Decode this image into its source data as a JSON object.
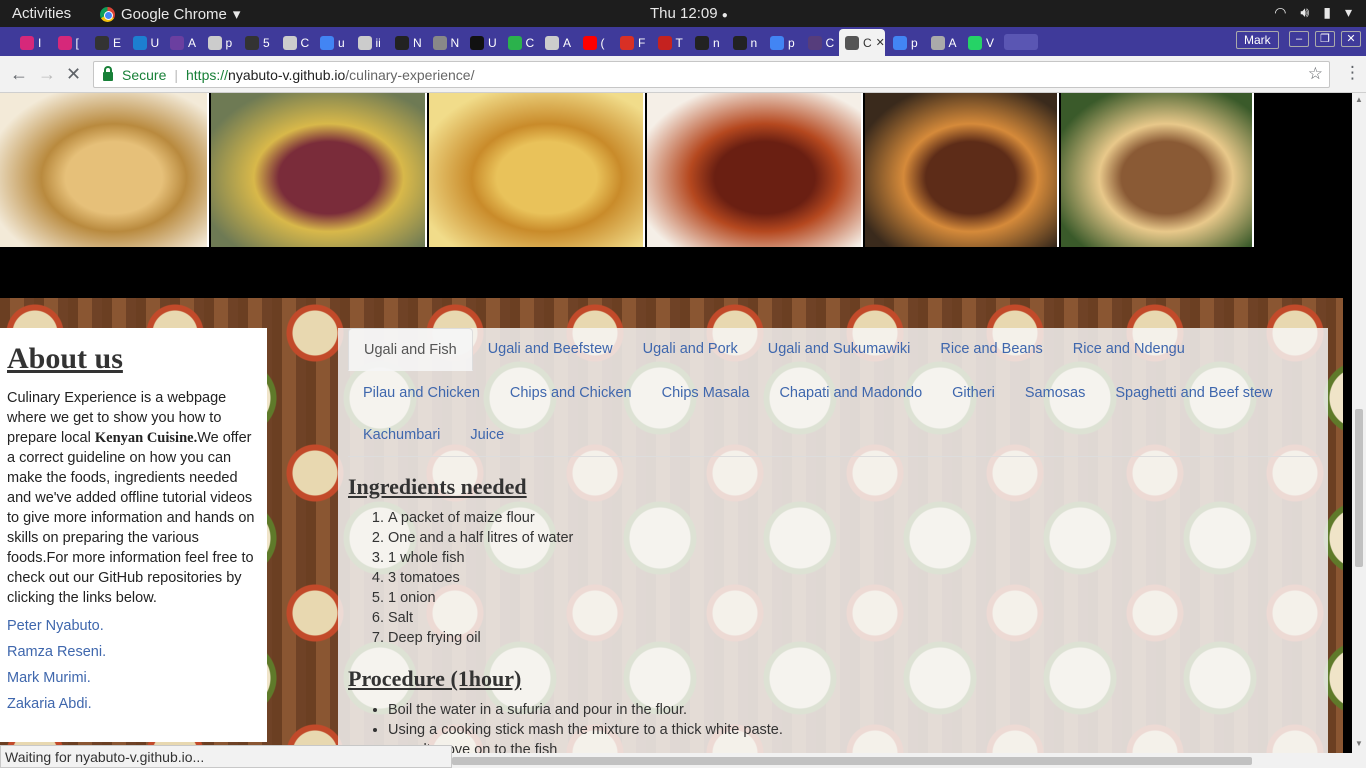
{
  "topbar": {
    "activities": "Activities",
    "app_name": "Google Chrome",
    "clock": "Thu 12:09",
    "clock_dot": "●"
  },
  "tabs": [
    {
      "label": "I",
      "color": "#d6287a"
    },
    {
      "label": "[",
      "color": "#d6287a"
    },
    {
      "label": "E",
      "color": "#333333"
    },
    {
      "label": "U",
      "color": "#1d7fd1"
    },
    {
      "label": "A",
      "color": "#6b3fa0"
    },
    {
      "label": "p",
      "color": "#cccccc"
    },
    {
      "label": "5",
      "color": "#333333"
    },
    {
      "label": "C",
      "color": "#cccccc"
    },
    {
      "label": "u",
      "color": "#4285f4"
    },
    {
      "label": "ii",
      "color": "#cccccc"
    },
    {
      "label": "N",
      "color": "#222222"
    },
    {
      "label": "N",
      "color": "#888888"
    },
    {
      "label": "U",
      "color": "#111111"
    },
    {
      "label": "C",
      "color": "#2bb24c"
    },
    {
      "label": "A",
      "color": "#cccccc"
    },
    {
      "label": "(",
      "color": "#ff0000"
    },
    {
      "label": "F",
      "color": "#d93025"
    },
    {
      "label": "T",
      "color": "#c5221f"
    },
    {
      "label": "n",
      "color": "#222222"
    },
    {
      "label": "n",
      "color": "#222222"
    },
    {
      "label": "p",
      "color": "#4285f4"
    },
    {
      "label": "C",
      "color": "#563d7c"
    },
    {
      "label": "C",
      "color": "#555555",
      "active": true
    },
    {
      "label": "p",
      "color": "#4285f4"
    },
    {
      "label": "A",
      "color": "#aaaaaa"
    },
    {
      "label": "V",
      "color": "#25d366"
    }
  ],
  "profile": "Mark",
  "toolbar": {
    "secure": "Secure",
    "url_proto": "https://",
    "url_host": "nyabuto-v.github.io",
    "url_path": "/culinary-experience/"
  },
  "gallery": {
    "images": [
      {
        "name": "samosas-image",
        "colors": [
          "#e6c079",
          "#b98a3e",
          "#f3ead8"
        ]
      },
      {
        "name": "ugali-plate-image",
        "colors": [
          "#7a2c3a",
          "#d8b84a",
          "#6e7a54"
        ]
      },
      {
        "name": "chips-image",
        "colors": [
          "#e9c25a",
          "#c98b2a",
          "#f1dc8a"
        ]
      },
      {
        "name": "chicken-image",
        "colors": [
          "#6a1f12",
          "#b5481f",
          "#f5efe7"
        ]
      },
      {
        "name": "spaghetti-image",
        "colors": [
          "#5d2c18",
          "#d58a3a",
          "#3a2a1c"
        ]
      },
      {
        "name": "pizza-image",
        "colors": [
          "#8a5a35",
          "#e8c88a",
          "#3a5a2a"
        ]
      }
    ]
  },
  "about": {
    "title": "About us",
    "text_before": "Culinary Experience is a webpage where we get to show you how to prepare local ",
    "text_bold": "Kenyan Cuisine.",
    "text_after": "We offer a correct guideline on how you can make the foods, ingredients needed and we've added offline tutorial videos to give more information and hands on skills on preparing the various foods.For more information feel free to check out our GitHub repositories by clicking the links below.",
    "links": [
      "Peter Nyabuto.",
      "Ramza Reseni.",
      "Mark Murimi.",
      "Zakaria Abdi."
    ]
  },
  "food_tabs": [
    "Ugali and Fish",
    "Ugali and Beefstew",
    "Ugali and Pork",
    "Ugali and Sukumawiki",
    "Rice and Beans",
    "Rice and Ndengu",
    "Pilau and Chicken",
    "Chips and Chicken",
    "Chips Masala",
    "Chapati and Madondo",
    "Githeri",
    "Samosas",
    "Spaghetti and Beef stew",
    "Kachumbari",
    "Juice"
  ],
  "active_tab": "Ugali and Fish",
  "ingredients": {
    "title": "Ingredients needed",
    "items": [
      "A packet of maize flour",
      "One and a half litres of water",
      "1 whole fish",
      "3 tomatoes",
      "1 onion",
      "Salt",
      "Deep frying oil"
    ]
  },
  "procedure": {
    "title": "Procedure (1hour)",
    "steps": [
      "Boil the water in a sufuria and pour in the flour.",
      "Using a cooking stick mash the mixture to a thick white paste.",
      "...esult move on to the fish"
    ]
  },
  "status": "Waiting for nyabuto-v.github.io..."
}
